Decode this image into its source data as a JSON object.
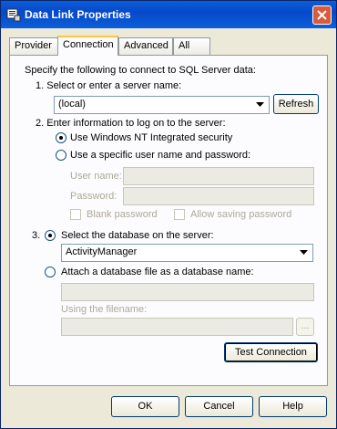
{
  "window": {
    "title": "Data Link Properties",
    "title_icon": "data-link-icon",
    "close_icon": "close-icon"
  },
  "tabs": [
    {
      "label": "Provider",
      "active": false
    },
    {
      "label": "Connection",
      "active": true
    },
    {
      "label": "Advanced",
      "active": false
    },
    {
      "label": "All",
      "active": false
    }
  ],
  "connection": {
    "intro": "Specify the following to connect to SQL Server data:",
    "step1_label": "1. Select or enter a server name:",
    "server_value": "(local)",
    "refresh_label": "Refresh",
    "step2_label": "2. Enter information to log on to the server:",
    "nt_security_label": "Use Windows NT Integrated security",
    "specific_user_label": "Use a specific user name and password:",
    "user_name_label": "User name:",
    "password_label": "Password:",
    "blank_password_label": "Blank password",
    "allow_saving_label": "Allow saving password",
    "step3_prefix": "3.",
    "select_db_label": "Select the database on the server:",
    "database_value": "ActivityManager",
    "attach_label": "Attach a database file as a database name:",
    "using_filename_label": "Using the filename:",
    "browse_label": "...",
    "test_connection_label": "Test Connection"
  },
  "footer": {
    "ok_label": "OK",
    "cancel_label": "Cancel",
    "help_label": "Help"
  }
}
